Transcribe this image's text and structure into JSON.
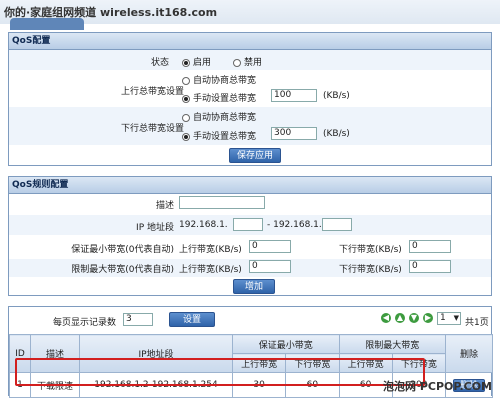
{
  "watermark": "你的·家庭组网频道 wireless.it168.com",
  "qos": {
    "title": "QoS配置",
    "status_label": "状态",
    "status_on": "启用",
    "status_off": "禁用",
    "up_label": "上行总带宽设置",
    "up_auto": "自动协商总带宽",
    "up_manual": "手动设置总带宽",
    "up_value": "100",
    "up_unit": "(KB/s)",
    "down_label": "下行总带宽设置",
    "down_auto": "自动协商总带宽",
    "down_manual": "手动设置总带宽",
    "down_value": "300",
    "down_unit": "(KB/s)",
    "save_btn": "保存应用"
  },
  "rule": {
    "title": "QoS规则配置",
    "desc_label": "描述",
    "ip_label": "IP 地址段",
    "ip_start": "192.168.1.",
    "ip_sep": "- 192.168.1.",
    "min_label": "保证最小带宽(0代表自动)",
    "max_label": "限制最大带宽(0代表自动)",
    "up_kb": "上行带宽(KB/s)",
    "down_kb": "下行带宽(KB/s)",
    "zero": "0",
    "add_btn": "增加"
  },
  "list": {
    "per_page_label": "每页显示记录数",
    "per_page_value": "3",
    "set_btn": "设置",
    "page_value": "1",
    "total_pages": "共1页",
    "headers": {
      "id": "ID",
      "desc": "描述",
      "ip": "IP地址段",
      "min": "保证最小带宽",
      "max": "限制最大带宽",
      "del": "删除",
      "up": "上行带宽",
      "down": "下行带宽"
    },
    "rows": [
      {
        "id": "1",
        "desc": "下载限速",
        "ip": "192.168.1.2-192.168.1.254",
        "min_up": "30",
        "min_down": "60",
        "max_up": "60",
        "max_down": "200",
        "del": "删除"
      }
    ]
  },
  "footer": "泡泡网  PCPOP.COM"
}
